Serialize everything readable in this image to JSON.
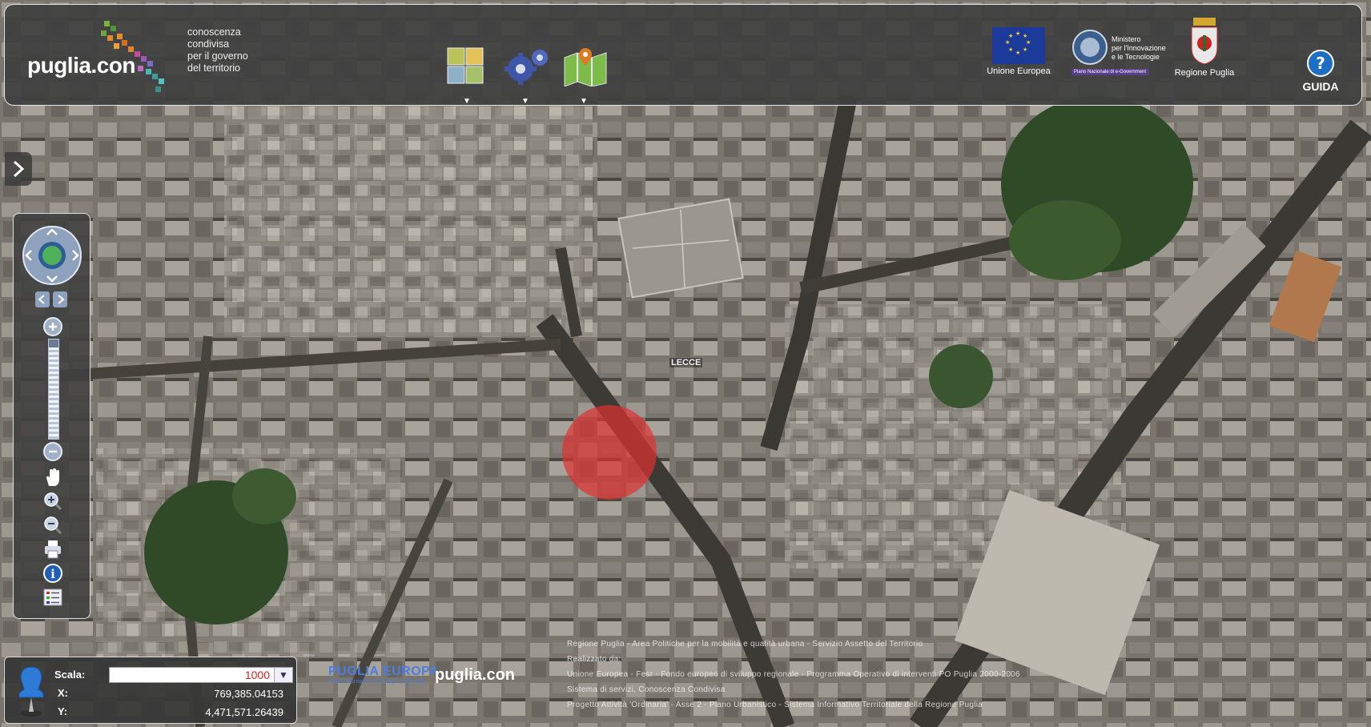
{
  "header": {
    "brand": "puglia.con",
    "tagline": [
      "conoscenza",
      "condivisa",
      "per il governo",
      "del territorio"
    ],
    "tools": [
      {
        "icon": "layers-grid-icon",
        "arrow": "▼"
      },
      {
        "icon": "gears-icon",
        "arrow": "▼"
      },
      {
        "icon": "map-marker-icon",
        "arrow": "▼"
      }
    ],
    "partners": {
      "eu": "Unione Europea",
      "ministero": [
        "Ministero",
        "per l'Innovazione",
        "e le Tecnologie"
      ],
      "ministero_sub": "Piano Nazionale di e-Government",
      "regione": "Regione Puglia"
    },
    "help": "GUIDA"
  },
  "map": {
    "place_label": "LECCE",
    "marker_color": "#e03030"
  },
  "coords": {
    "scale_label": "Scala:",
    "scale_value": "1000",
    "x_label": "X:",
    "x_value": "769,385.04153",
    "y_label": "Y:",
    "y_value": "4,471,571.26439"
  },
  "bottom": {
    "puglia_europa": "PUGLIA EUROPA",
    "puglia_europa_sub": "Fondo Europeo di sviluppo regionale",
    "puglia_con": "puglia.con",
    "credits": [
      "Regione Puglia - Area Politiche per la mobilità e qualità urbana - Servizio Assetto del Territorio",
      "Realizzato da:",
      "Unione Europea - Fesr - Fondo europeo di sviluppo regionale - Programma Operativo di interventi PO Puglia 2000-2006",
      "Sistema di servizi, Conoscenza Condivisa",
      "Progetto Attività 'Ordinaria' - Asse 2 - Piano Urbanistico - Sistema Informativo Territoriale della Regione Puglia"
    ]
  }
}
